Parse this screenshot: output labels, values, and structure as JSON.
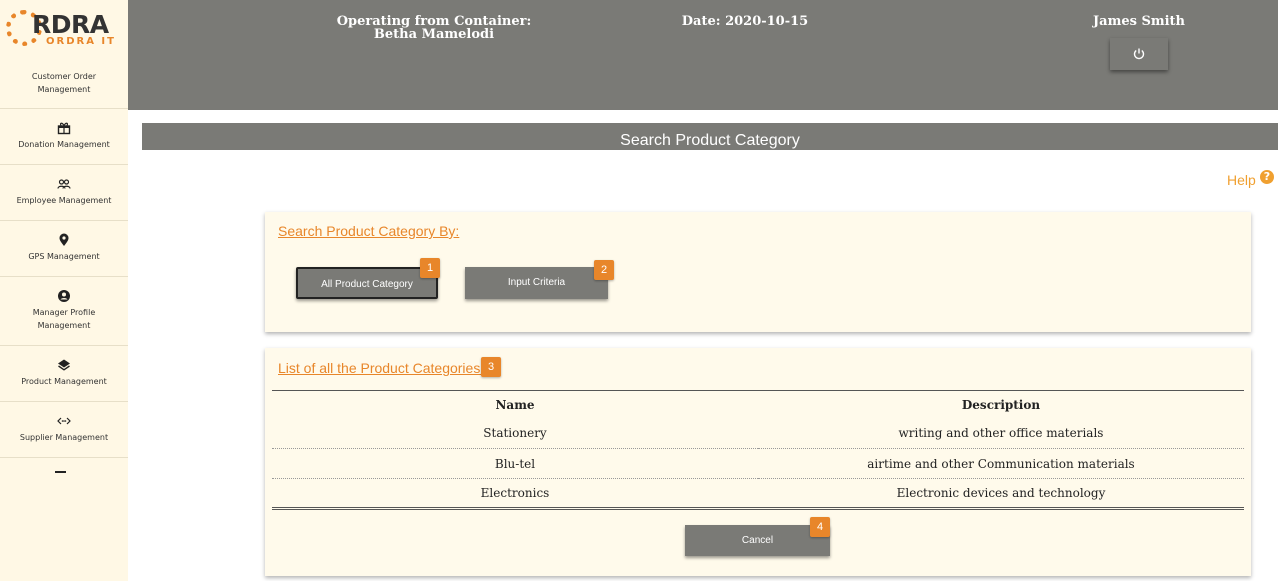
{
  "logo": {
    "brand": "RDRA",
    "sub": "ORDRA IT"
  },
  "sidebar": {
    "items": [
      {
        "label": "Customer Order Management",
        "icon": "none"
      },
      {
        "label": "Donation Management",
        "icon": "gift-icon"
      },
      {
        "label": "Employee Management",
        "icon": "people-icon"
      },
      {
        "label": "GPS Management",
        "icon": "location-pin-icon"
      },
      {
        "label": "Manager Profile Management",
        "icon": "account-circle-icon"
      },
      {
        "label": "Product Management",
        "icon": "layers-icon"
      },
      {
        "label": "Supplier Management",
        "icon": "swap-arrows-icon"
      }
    ],
    "collapse_icon": "minus-icon"
  },
  "header": {
    "container_label": "Operating from Container:",
    "container_name": "Betha Mamelodi",
    "date": "Date: 2020-10-15",
    "user": "James Smith",
    "power_icon": "power-icon"
  },
  "page_title": "Search Product Category",
  "help": {
    "label": "Help",
    "icon": "question-circle-icon"
  },
  "search_panel": {
    "heading": "Search Product Category By:",
    "all_button": "All Product Category",
    "criteria_button": "Input Criteria",
    "badge_all": "1",
    "badge_criteria": "2"
  },
  "list_panel": {
    "heading": "List of all the Product Categories:",
    "badge": "3",
    "columns": [
      "Name",
      "Description"
    ],
    "rows": [
      [
        "Stationery",
        "writing and other office materials"
      ],
      [
        "Blu-tel",
        "airtime and other Communication materials"
      ],
      [
        "Electronics",
        "Electronic devices and technology"
      ]
    ],
    "cancel_button": "Cancel",
    "badge_cancel": "4"
  },
  "colors": {
    "accent": "#e8862a",
    "header_gray": "#7a7a76",
    "sidebar_bg": "#fff8e5",
    "panel_bg": "#fffaeb"
  }
}
